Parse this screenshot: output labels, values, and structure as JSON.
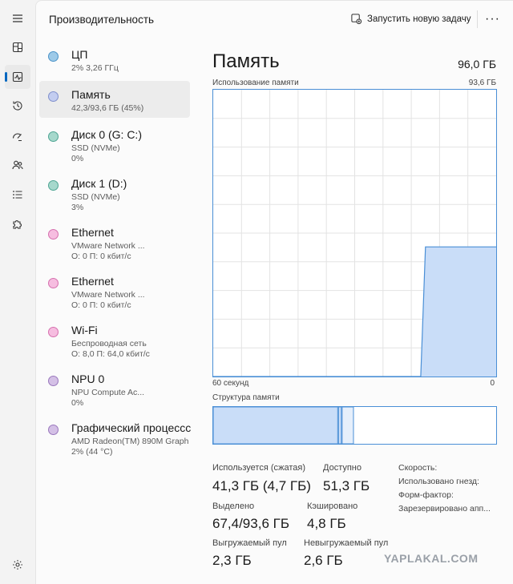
{
  "header": {
    "title": "Производительность",
    "run_task": "Запустить новую задачу",
    "more": "···"
  },
  "devices": [
    {
      "name": "ЦП",
      "sub1": "2% 3,26 ГГц",
      "sub2": "",
      "color": "#9ecae8",
      "border": "#4b93c8"
    },
    {
      "name": "Память",
      "sub1": "42,3/93,6 ГБ (45%)",
      "sub2": "",
      "color": "#c3cdf0",
      "border": "#8090cc"
    },
    {
      "name": "Диск 0 (G: C:)",
      "sub1": "SSD (NVMe)",
      "sub2": "0%",
      "color": "#a6d8cc",
      "border": "#4fa593"
    },
    {
      "name": "Диск 1 (D:)",
      "sub1": "SSD (NVMe)",
      "sub2": "3%",
      "color": "#a6d8cc",
      "border": "#4fa593"
    },
    {
      "name": "Ethernet",
      "sub1": "VMware Network ...",
      "sub2": "О: 0 П: 0 кбит/с",
      "color": "#f6bde0",
      "border": "#d670ae"
    },
    {
      "name": "Ethernet",
      "sub1": "VMware Network ...",
      "sub2": "О: 0 П: 0 кбит/с",
      "color": "#f6bde0",
      "border": "#d670ae"
    },
    {
      "name": "Wi-Fi",
      "sub1": "Беспроводная сеть",
      "sub2": "О: 8,0 П: 64,0 кбит/с",
      "color": "#f6bde0",
      "border": "#d670ae"
    },
    {
      "name": "NPU 0",
      "sub1": "NPU Compute Ac...",
      "sub2": "0%",
      "color": "#d4c0e6",
      "border": "#9a78bd"
    },
    {
      "name": "Графический процессс",
      "sub1": "AMD Radeon(TM) 890M Graph",
      "sub2": "2% (44 °C)",
      "color": "#d4c0e6",
      "border": "#9a78bd"
    }
  ],
  "detail": {
    "title": "Память",
    "total": "96,0 ГБ",
    "usage_label": "Использование памяти",
    "usage_max": "93,6 ГБ",
    "axis_left": "60 секунд",
    "axis_right": "0",
    "structure_label": "Структура памяти"
  },
  "chart_data": {
    "type": "area",
    "x_range_seconds": [
      60,
      0
    ],
    "y_range": [
      0,
      93.6
    ],
    "series": [
      {
        "values_note_free": "",
        "values": [
          0,
          0,
          0,
          0,
          0,
          0,
          0,
          0,
          0,
          0,
          0,
          0,
          0,
          0,
          0,
          0,
          0,
          0,
          0,
          0,
          0,
          0,
          0,
          0,
          0,
          0,
          0,
          0,
          0,
          0,
          0,
          0,
          0,
          0,
          0,
          0,
          0,
          0,
          0,
          0,
          0,
          0,
          0,
          0,
          0,
          42.3,
          42.3,
          42.3,
          42.3,
          42.3,
          42.3,
          42.3,
          42.3,
          42.3,
          42.3,
          42.3,
          42.3,
          42.3,
          42.3,
          42.3,
          42.3
        ]
      }
    ],
    "grid": true,
    "fill_color": "#c9ddf8",
    "line_color": "#4a8fd6"
  },
  "structure": {
    "used_fraction": 0.44,
    "modified_fraction": 0.01,
    "standby_fraction": 0.04
  },
  "stats": {
    "in_use_label": "Используется (сжатая)",
    "in_use_value": "41,3 ГБ (4,7 ГБ)",
    "available_label": "Доступно",
    "available_value": "51,3 ГБ",
    "committed_label": "Выделено",
    "committed_value": "67,4/93,6 ГБ",
    "cached_label": "Кэшировано",
    "cached_value": "4,8 ГБ",
    "paged_label": "Выгружаемый пул",
    "paged_value": "2,3 ГБ",
    "nonpaged_label": "Невыгружаемый пул",
    "nonpaged_value": "2,6 ГБ",
    "speed_label": "Скорость:",
    "slots_label": "Использовано гнезд:",
    "form_label": "Форм-фактор:",
    "reserved_label": "Зарезервировано апп..."
  },
  "watermark": "YAPLAKAL.COM"
}
